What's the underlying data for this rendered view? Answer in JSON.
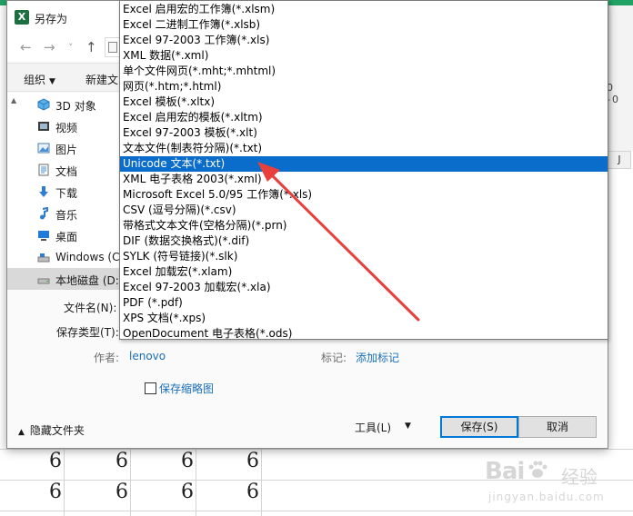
{
  "window": {
    "title": "另存为",
    "app_badge": "X"
  },
  "nav": {
    "back": "←",
    "forward": "→",
    "recent": "˅",
    "up": "↑"
  },
  "commandbar": {
    "organize": "组织",
    "new_folder": "新建文"
  },
  "sidebar": {
    "items": [
      {
        "label": "3D 对象",
        "icon": "cube-icon"
      },
      {
        "label": "视频",
        "icon": "video-icon"
      },
      {
        "label": "图片",
        "icon": "picture-icon"
      },
      {
        "label": "文档",
        "icon": "document-icon"
      },
      {
        "label": "下载",
        "icon": "download-icon"
      },
      {
        "label": "音乐",
        "icon": "music-icon"
      },
      {
        "label": "桌面",
        "icon": "desktop-icon"
      },
      {
        "label": "Windows (C:",
        "icon": "drive-icon"
      },
      {
        "label": "本地磁盘 (D:",
        "icon": "drive-icon"
      }
    ],
    "selected_index": 8
  },
  "form": {
    "filename_label": "文件名(N):",
    "filetype_label": "保存类型(T):",
    "author_label": "作者:",
    "author_value": "lenovo",
    "tags_label": "标记:",
    "tags_value": "添加标记",
    "thumbnail_label": "保存缩略图",
    "thumbnail_checked": false
  },
  "footer": {
    "hide_folders": "隐藏文件夹",
    "tools": "工具(L)",
    "save": "保存(S)",
    "cancel": "取消"
  },
  "dropdown": {
    "selected_index": 10,
    "items": [
      "Excel 启用宏的工作簿(*.xlsm)",
      "Excel 二进制工作簿(*.xlsb)",
      "Excel 97-2003 工作簿(*.xls)",
      "XML 数据(*.xml)",
      "单个文件网页(*.mht;*.mhtml)",
      "网页(*.htm;*.html)",
      "Excel 模板(*.xltx)",
      "Excel 启用宏的模板(*.xltm)",
      "Excel 97-2003 模板(*.xlt)",
      "文本文件(制表符分隔)(*.txt)",
      "Unicode 文本(*.txt)",
      "XML 电子表格 2003(*.xml)",
      "Microsoft Excel 5.0/95 工作簿(*.xls)",
      "CSV (逗号分隔)(*.csv)",
      "带格式文本文件(空格分隔)(*.prn)",
      "DIF (数据交换格式)(*.dif)",
      "SYLK (符号链接)(*.slk)",
      "Excel 加载宏(*.xlam)",
      "Excel 97-2003 加载宏(*.xla)",
      "PDF (*.pdf)",
      "XPS 文档(*.xps)",
      "OpenDocument 电子表格(*.ods)"
    ]
  },
  "sheet": {
    "column_header": "J",
    "ribbon_glyphs": "0 -0",
    "rows": [
      [
        "6",
        "6",
        "6",
        "6"
      ],
      [
        "6",
        "6",
        "6",
        "6"
      ]
    ]
  },
  "watermark": {
    "brand": "Bai",
    "suffix": "经验",
    "url": "jingyan.baidu.com"
  },
  "colors": {
    "selection": "#0a6ccb",
    "arrow": "#e8403c",
    "link": "#1a6fb8",
    "excel_green": "#1d6f42"
  }
}
